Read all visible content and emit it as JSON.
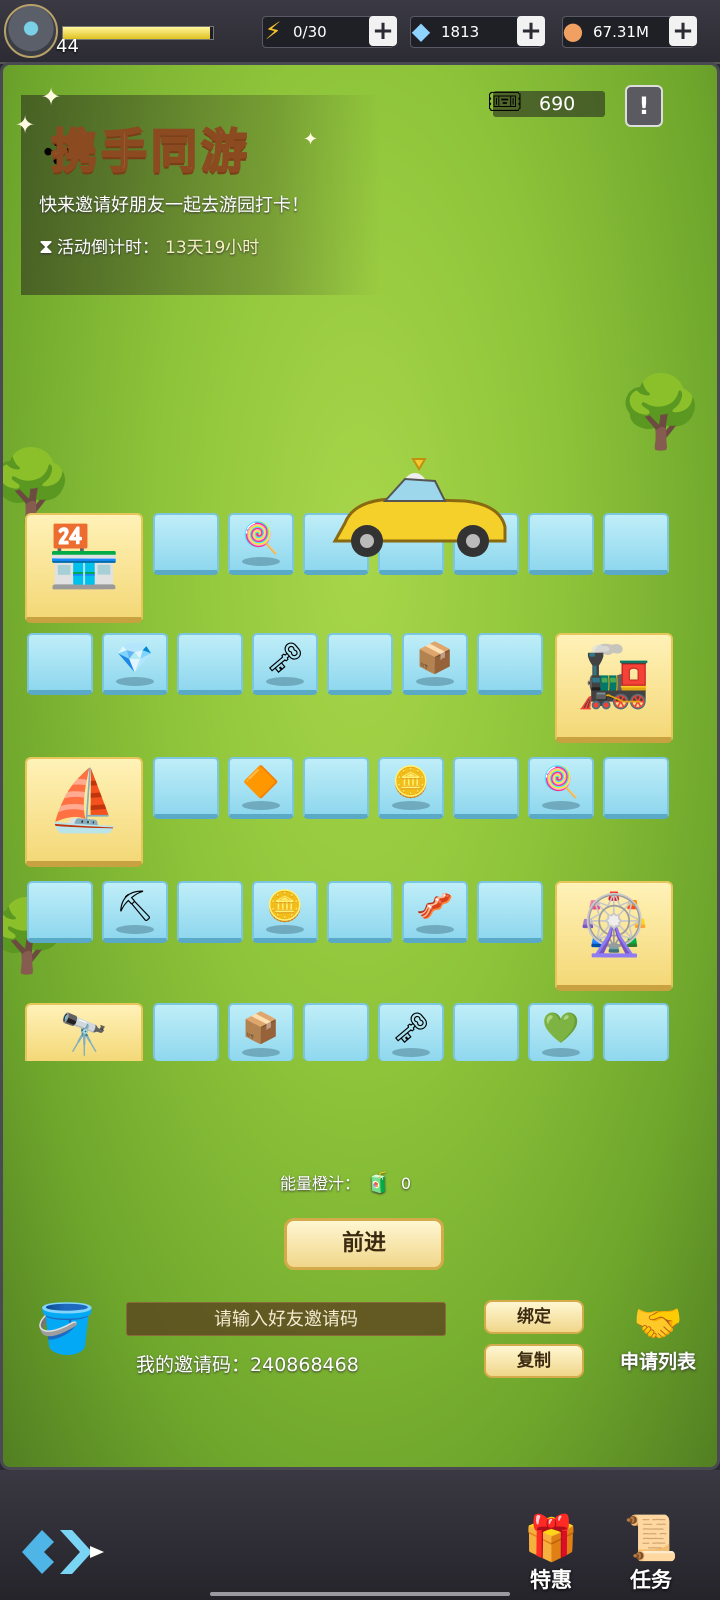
{
  "header": {
    "level": "44",
    "xp_fraction": 0.98,
    "energy": "0/30",
    "diamonds": "1813",
    "gold": "67.31M",
    "icons": {
      "energy": "lightning-icon",
      "diamond": "diamond-icon",
      "gold": "coin-icon",
      "add": "plus-icon"
    }
  },
  "event": {
    "title": "携手同游",
    "subtitle": "快来邀请好朋友一起去游园打卡！",
    "countdown_label": "活动倒计时：",
    "countdown_value": "13天19小时",
    "ticket_count": "690",
    "info_label": "!"
  },
  "board": {
    "row1_items": [
      "",
      "candy",
      "",
      "",
      "",
      "",
      ""
    ],
    "row2_items": [
      "",
      "diamond",
      "",
      "key",
      "",
      "box",
      ""
    ],
    "row3_items": [
      "",
      "crystal",
      "",
      "coin",
      "",
      "candy",
      ""
    ],
    "row4_items": [
      "",
      "pickaxe",
      "",
      "coin",
      "",
      "bacon",
      ""
    ],
    "row5_items": [
      "",
      "box",
      "",
      "key",
      "",
      "gem",
      ""
    ],
    "item_glyphs": {
      "candy": "🍭",
      "diamond": "💎",
      "key": "🗝",
      "box": "📦",
      "crystal": "🔶",
      "coin": "🪙",
      "pickaxe": "⛏",
      "bacon": "🥓",
      "gem": "💚"
    },
    "buildings": [
      "shop",
      "train",
      "ship",
      "ferris-wheel",
      "telescope"
    ]
  },
  "controls": {
    "juice_label": "能量橙汁：",
    "juice_count": "0",
    "go_label": "前进",
    "code_placeholder": "请输入好友邀请码",
    "my_code_label": "我的邀请码：",
    "my_code": "240868468",
    "bind_label": "绑定",
    "copy_label": "复制",
    "apply_list_label": "申请列表"
  },
  "nav": {
    "special_offer_label": "特惠",
    "tasks_label": "任务"
  },
  "colors": {
    "grass": "#8ec43a",
    "tile": "#9adcf0",
    "building_tile": "#f4d878",
    "button": "#f0d68a"
  }
}
